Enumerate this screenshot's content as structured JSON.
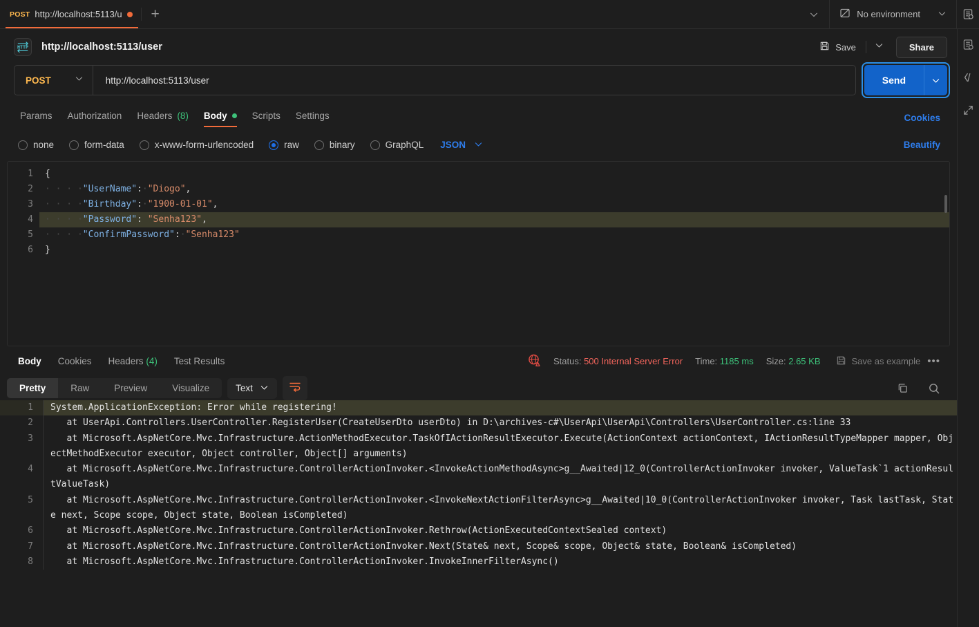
{
  "tabbar": {
    "request_tab": {
      "method": "POST",
      "name": "http://localhost:5113/u"
    },
    "new_tab_label": "+",
    "environment": {
      "label": "No environment"
    }
  },
  "request_header": {
    "protocol_badge": "HTTP",
    "title": "http://localhost:5113/user",
    "save_label": "Save",
    "share_label": "Share"
  },
  "url_bar": {
    "method": "POST",
    "url": "http://localhost:5113/user",
    "send_label": "Send"
  },
  "request_tabs": [
    {
      "label": "Params",
      "count": "",
      "active": false
    },
    {
      "label": "Authorization",
      "count": "",
      "active": false
    },
    {
      "label": "Headers",
      "count": "(8)",
      "active": false
    },
    {
      "label": "Body",
      "count": "",
      "active": true
    },
    {
      "label": "Scripts",
      "count": "",
      "active": false
    },
    {
      "label": "Settings",
      "count": "",
      "active": false
    }
  ],
  "cookies_link": "Cookies",
  "body_types": [
    {
      "label": "none",
      "selected": false
    },
    {
      "label": "form-data",
      "selected": false
    },
    {
      "label": "x-www-form-urlencoded",
      "selected": false
    },
    {
      "label": "raw",
      "selected": true
    },
    {
      "label": "binary",
      "selected": false
    },
    {
      "label": "GraphQL",
      "selected": false
    }
  ],
  "body_format": "JSON",
  "beautify_link": "Beautify",
  "editor": {
    "line_numbers": [
      "1",
      "2",
      "3",
      "4",
      "5",
      "6"
    ],
    "lines": [
      {
        "n": "1",
        "text": "{",
        "highlighted": false
      },
      {
        "n": "2",
        "text": "    \"UserName\": \"Diogo\",",
        "highlighted": false
      },
      {
        "n": "3",
        "text": "    \"Birthday\": \"1900-01-01\",",
        "highlighted": false
      },
      {
        "n": "4",
        "text": "    \"Password\": \"Senha123\",",
        "highlighted": true
      },
      {
        "n": "5",
        "text": "    \"ConfirmPassword\": \"Senha123\"",
        "highlighted": false
      },
      {
        "n": "6",
        "text": "}",
        "highlighted": false
      }
    ]
  },
  "response_tabs": [
    {
      "label": "Body",
      "count": "",
      "active": true
    },
    {
      "label": "Cookies",
      "count": "",
      "active": false
    },
    {
      "label": "Headers",
      "count": "(4)",
      "active": false
    },
    {
      "label": "Test Results",
      "count": "",
      "active": false
    }
  ],
  "response_status": {
    "status_label": "Status:",
    "status_value": "500 Internal Server Error",
    "time_label": "Time:",
    "time_value": "1185 ms",
    "size_label": "Size:",
    "size_value": "2.65 KB",
    "save_as_example": "Save as example",
    "more_label": "•••"
  },
  "response_view": {
    "modes": [
      {
        "label": "Pretty",
        "active": true
      },
      {
        "label": "Raw",
        "active": false
      },
      {
        "label": "Preview",
        "active": false
      },
      {
        "label": "Visualize",
        "active": false
      }
    ],
    "format": "Text"
  },
  "response_body": {
    "lines": [
      {
        "n": "1",
        "text": "System.ApplicationException: Error while registering!",
        "highlighted": true
      },
      {
        "n": "2",
        "text": "   at UserApi.Controllers.UserController.RegisterUser(CreateUserDto userDto) in D:\\archives-c#\\UserApi\\UserApi\\Controllers\\UserController.cs:line 33",
        "highlighted": false
      },
      {
        "n": "3",
        "text": "   at Microsoft.AspNetCore.Mvc.Infrastructure.ActionMethodExecutor.TaskOfIActionResultExecutor.Execute(ActionContext actionContext, IActionResultTypeMapper mapper, ObjectMethodExecutor executor, Object controller, Object[] arguments)",
        "highlighted": false
      },
      {
        "n": "4",
        "text": "   at Microsoft.AspNetCore.Mvc.Infrastructure.ControllerActionInvoker.<InvokeActionMethodAsync>g__Awaited|12_0(ControllerActionInvoker invoker, ValueTask`1 actionResultValueTask)",
        "highlighted": false
      },
      {
        "n": "5",
        "text": "   at Microsoft.AspNetCore.Mvc.Infrastructure.ControllerActionInvoker.<InvokeNextActionFilterAsync>g__Awaited|10_0(ControllerActionInvoker invoker, Task lastTask, State next, Scope scope, Object state, Boolean isCompleted)",
        "highlighted": false
      },
      {
        "n": "6",
        "text": "   at Microsoft.AspNetCore.Mvc.Infrastructure.ControllerActionInvoker.Rethrow(ActionExecutedContextSealed context)",
        "highlighted": false
      },
      {
        "n": "7",
        "text": "   at Microsoft.AspNetCore.Mvc.Infrastructure.ControllerActionInvoker.Next(State& next, Scope& scope, Object& state, Boolean& isCompleted)",
        "highlighted": false
      },
      {
        "n": "8",
        "text": "   at Microsoft.AspNetCore.Mvc.Infrastructure.ControllerActionInvoker.InvokeInnerFilterAsync()",
        "highlighted": false
      }
    ]
  },
  "colors": {
    "accent_orange": "#f26b3a",
    "method_post": "#ffb94f",
    "link_blue": "#2e7dec",
    "send_blue": "#1263c9",
    "error_red": "#f3655c",
    "success_green": "#3dc27a"
  }
}
